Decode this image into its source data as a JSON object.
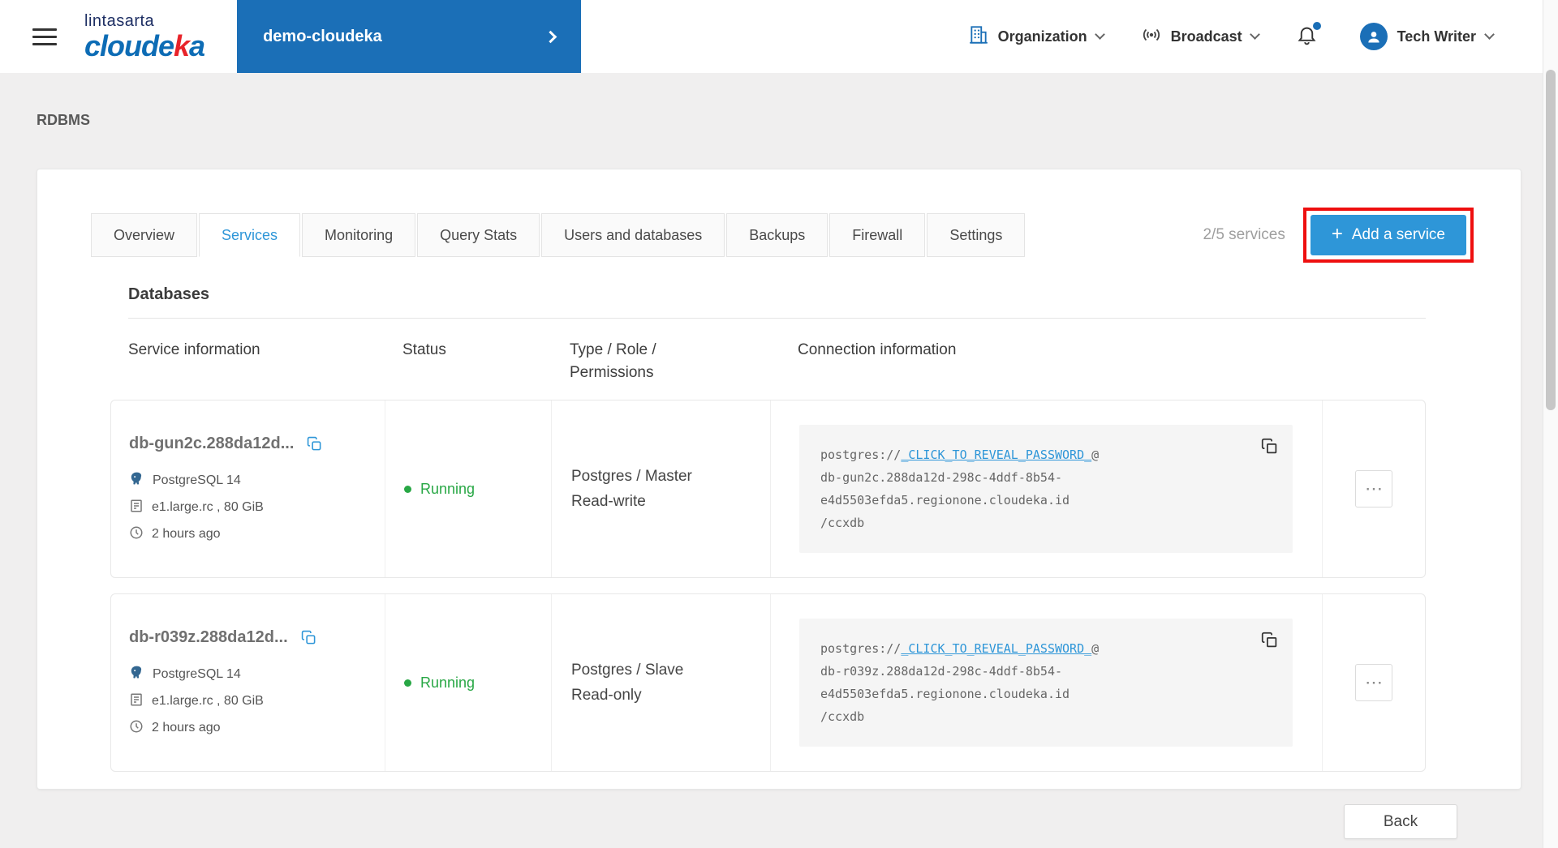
{
  "colors": {
    "accent_blue": "#2e96d8",
    "brand_blue": "#1b6fb7",
    "logo_blue": "#0d6cb5",
    "logo_red": "#e8232a",
    "status_green": "#28a745",
    "annotation_red": "#ee0f0f"
  },
  "header": {
    "logo_top": "lintasarta",
    "logo_pre": "cloude",
    "logo_k": "k",
    "logo_post": "a",
    "project": "demo-cloudeka",
    "organization": "Organization",
    "broadcast": "Broadcast",
    "user": "Tech Writer"
  },
  "breadcrumb": "RDBMS",
  "tabs": [
    "Overview",
    "Services",
    "Monitoring",
    "Query Stats",
    "Users and databases",
    "Backups",
    "Firewall",
    "Settings"
  ],
  "active_tab": "Services",
  "services_summary": "2/5 services",
  "add_service": {
    "plus": "+",
    "label": "Add a service"
  },
  "section_title": "Databases",
  "table": {
    "columns": [
      "Service information",
      "Status",
      "Type / Role / Permissions",
      "Connection information"
    ],
    "rows": [
      {
        "name": "db-gun2c.288da12d...",
        "engine": "PostgreSQL 14",
        "flavor": "e1.large.rc , 80 GiB",
        "created": "2 hours ago",
        "status": "Running",
        "role": "Postgres / Master",
        "permission": "Read-write",
        "conn": {
          "scheme": "postgres://",
          "password": "_CLICK_TO_REVEAL_PASSWORD_",
          "at": "@",
          "host_lines": [
            "db-gun2c.288da12d-298c-4ddf-8b54-",
            "e4d5503efda5.regionone.cloudeka.id",
            "/ccxdb"
          ]
        }
      },
      {
        "name": "db-r039z.288da12d...",
        "engine": "PostgreSQL 14",
        "flavor": "e1.large.rc , 80 GiB",
        "created": "2 hours ago",
        "status": "Running",
        "role": "Postgres / Slave",
        "permission": "Read-only",
        "conn": {
          "scheme": "postgres://",
          "password": "_CLICK_TO_REVEAL_PASSWORD_",
          "at": "@",
          "host_lines": [
            "db-r039z.288da12d-298c-4ddf-8b54-",
            "e4d5503efda5.regionone.cloudeka.id",
            "/ccxdb"
          ]
        }
      }
    ]
  },
  "icons": {
    "ellipsis": "⋯"
  },
  "back_label": "Back"
}
